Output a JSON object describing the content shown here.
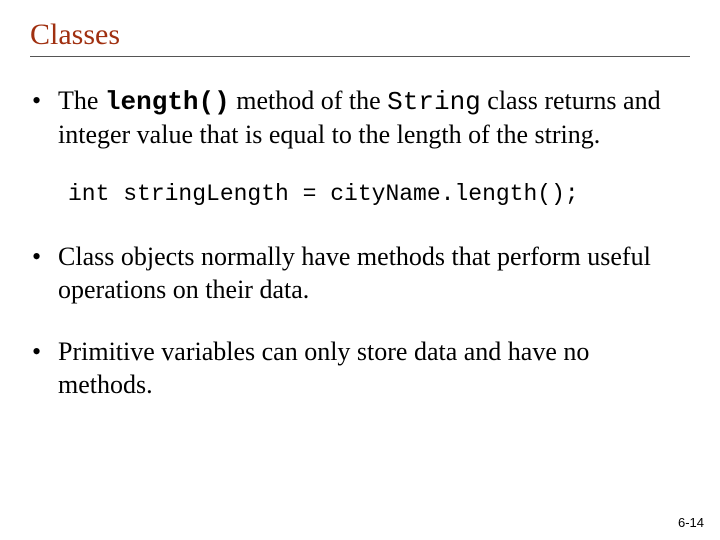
{
  "title": "Classes",
  "bullet1": {
    "pre": "The ",
    "code1": "length()",
    "mid": " method of the ",
    "code2": "String",
    "post": " class returns and integer value that is equal to the length of the string."
  },
  "codeline": "int stringLength = cityName.length();",
  "bullet2": "Class objects normally have methods that perform useful operations on their data.",
  "bullet3": "Primitive variables can only store data and have no methods.",
  "pagenum": "6-14"
}
